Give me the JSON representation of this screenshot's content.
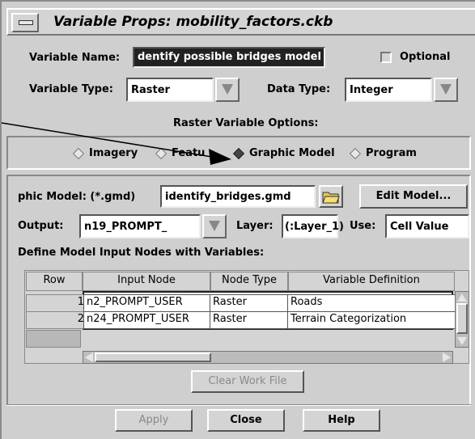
{
  "window": {
    "title": "Variable Props: mobility_factors.ckb"
  },
  "variable": {
    "name_label": "Variable Name:",
    "name_value": "dentify possible bridges model",
    "optional_label": "Optional",
    "optional_checked": false,
    "type_label": "Variable Type:",
    "type_value": "Raster",
    "data_type_label": "Data Type:",
    "data_type_value": "Integer"
  },
  "options": {
    "heading": "Raster Variable Options:",
    "radios": [
      {
        "label": "Imagery",
        "selected": false
      },
      {
        "label": "Featu",
        "selected": false
      },
      {
        "label": "Graphic Model",
        "selected": true
      },
      {
        "label": "Program",
        "selected": false
      }
    ]
  },
  "model": {
    "label": "phic Model: (*.gmd)",
    "value": "identify_bridges.gmd",
    "edit_button": "Edit Model...",
    "output_label": "Output:",
    "output_value": "n19_PROMPT_",
    "layer_label": "Layer:",
    "layer_value": "(:Layer_1)",
    "use_label": "Use:",
    "use_value": "Cell Value",
    "define_label": "Define Model Input Nodes with Variables:"
  },
  "table": {
    "headers": [
      "Row",
      "Input Node",
      "Node Type",
      "Variable Definition"
    ],
    "rows": [
      {
        "row": "1",
        "node": "n2_PROMPT_USER",
        "type": "Raster",
        "definition": "Roads"
      },
      {
        "row": "2",
        "node": "n24_PROMPT_USER",
        "type": "Raster",
        "definition": "Terrain Categorization"
      }
    ]
  },
  "buttons": {
    "clear_work_file": "Clear Work File",
    "apply": "Apply",
    "close": "Close",
    "help": "Help"
  },
  "icons": {
    "menu": "window-menu-icon",
    "folder": "open-folder-icon"
  },
  "colors": {
    "panel": "#cfcfcf",
    "selection": "#222222",
    "folder": "#e7c64a"
  }
}
